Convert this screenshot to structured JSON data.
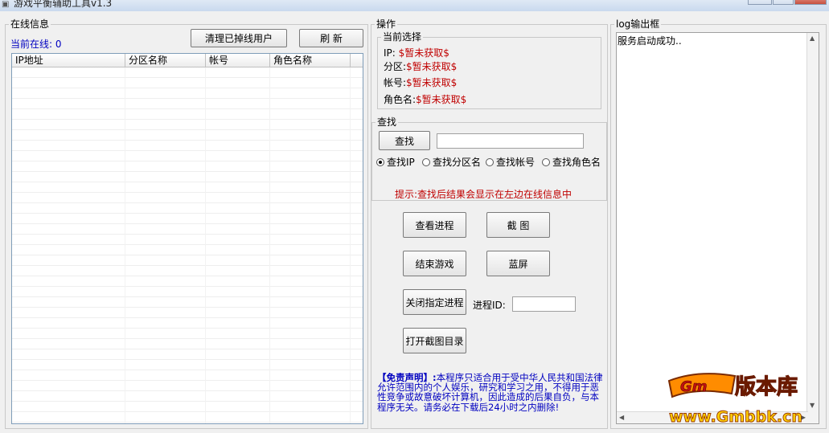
{
  "window": {
    "title": "游戏平衡辅助工具v1.3"
  },
  "online_panel": {
    "legend": "在线信息",
    "count_label": "当前在线: 0",
    "clear_button": "清理已掉线用户",
    "refresh_button": "刷  新",
    "columns": [
      "IP地址",
      "分区名称",
      "帐号",
      "角色名称"
    ]
  },
  "operation_panel": {
    "legend": "操作",
    "current_selection": {
      "legend": "当前选择",
      "ip_label": "IP:",
      "ip_value": "$暂未获取$",
      "zone_label": "分区:",
      "zone_value": "$暂未获取$",
      "account_label": "帐号:",
      "account_value": "$暂未获取$",
      "role_label": "角色名:",
      "role_value": "$暂未获取$"
    },
    "search": {
      "legend": "查找",
      "button": "查找",
      "input_value": "",
      "options": [
        "查找IP",
        "查找分区名",
        "查找帐号",
        "查找角色名"
      ],
      "selected_option": "查找IP",
      "hint": "提示:查找后结果会显示在左边在线信息中"
    },
    "actions": {
      "view_process": "查看进程",
      "screenshot": "截  图",
      "end_game": "结束游戏",
      "blue_screen": "蓝屏",
      "close_process": "关闭指定进程",
      "process_id_label": "进程ID:",
      "process_id_value": "",
      "open_screenshot_dir": "打开截图目录"
    },
    "disclaimer_title": "【免责声明】:",
    "disclaimer_body": "本程序只适合用于受中华人民共和国法律允许范围内的个人娱乐，研究和学习之用，不得用于恶性竞争或故意破坏计算机，因此造成的后果自负，与本程序无关。请务必在下载后24小时之内删除!"
  },
  "log_panel": {
    "legend": "log输出框",
    "content": "服务启动成功.."
  },
  "watermark": {
    "logo_text": "版本库",
    "url": "www.Gmbbk.cn"
  },
  "colors": {
    "accent_red": "#c00000",
    "accent_blue": "#0000c0",
    "watermark_orange": "#ff8c00"
  }
}
